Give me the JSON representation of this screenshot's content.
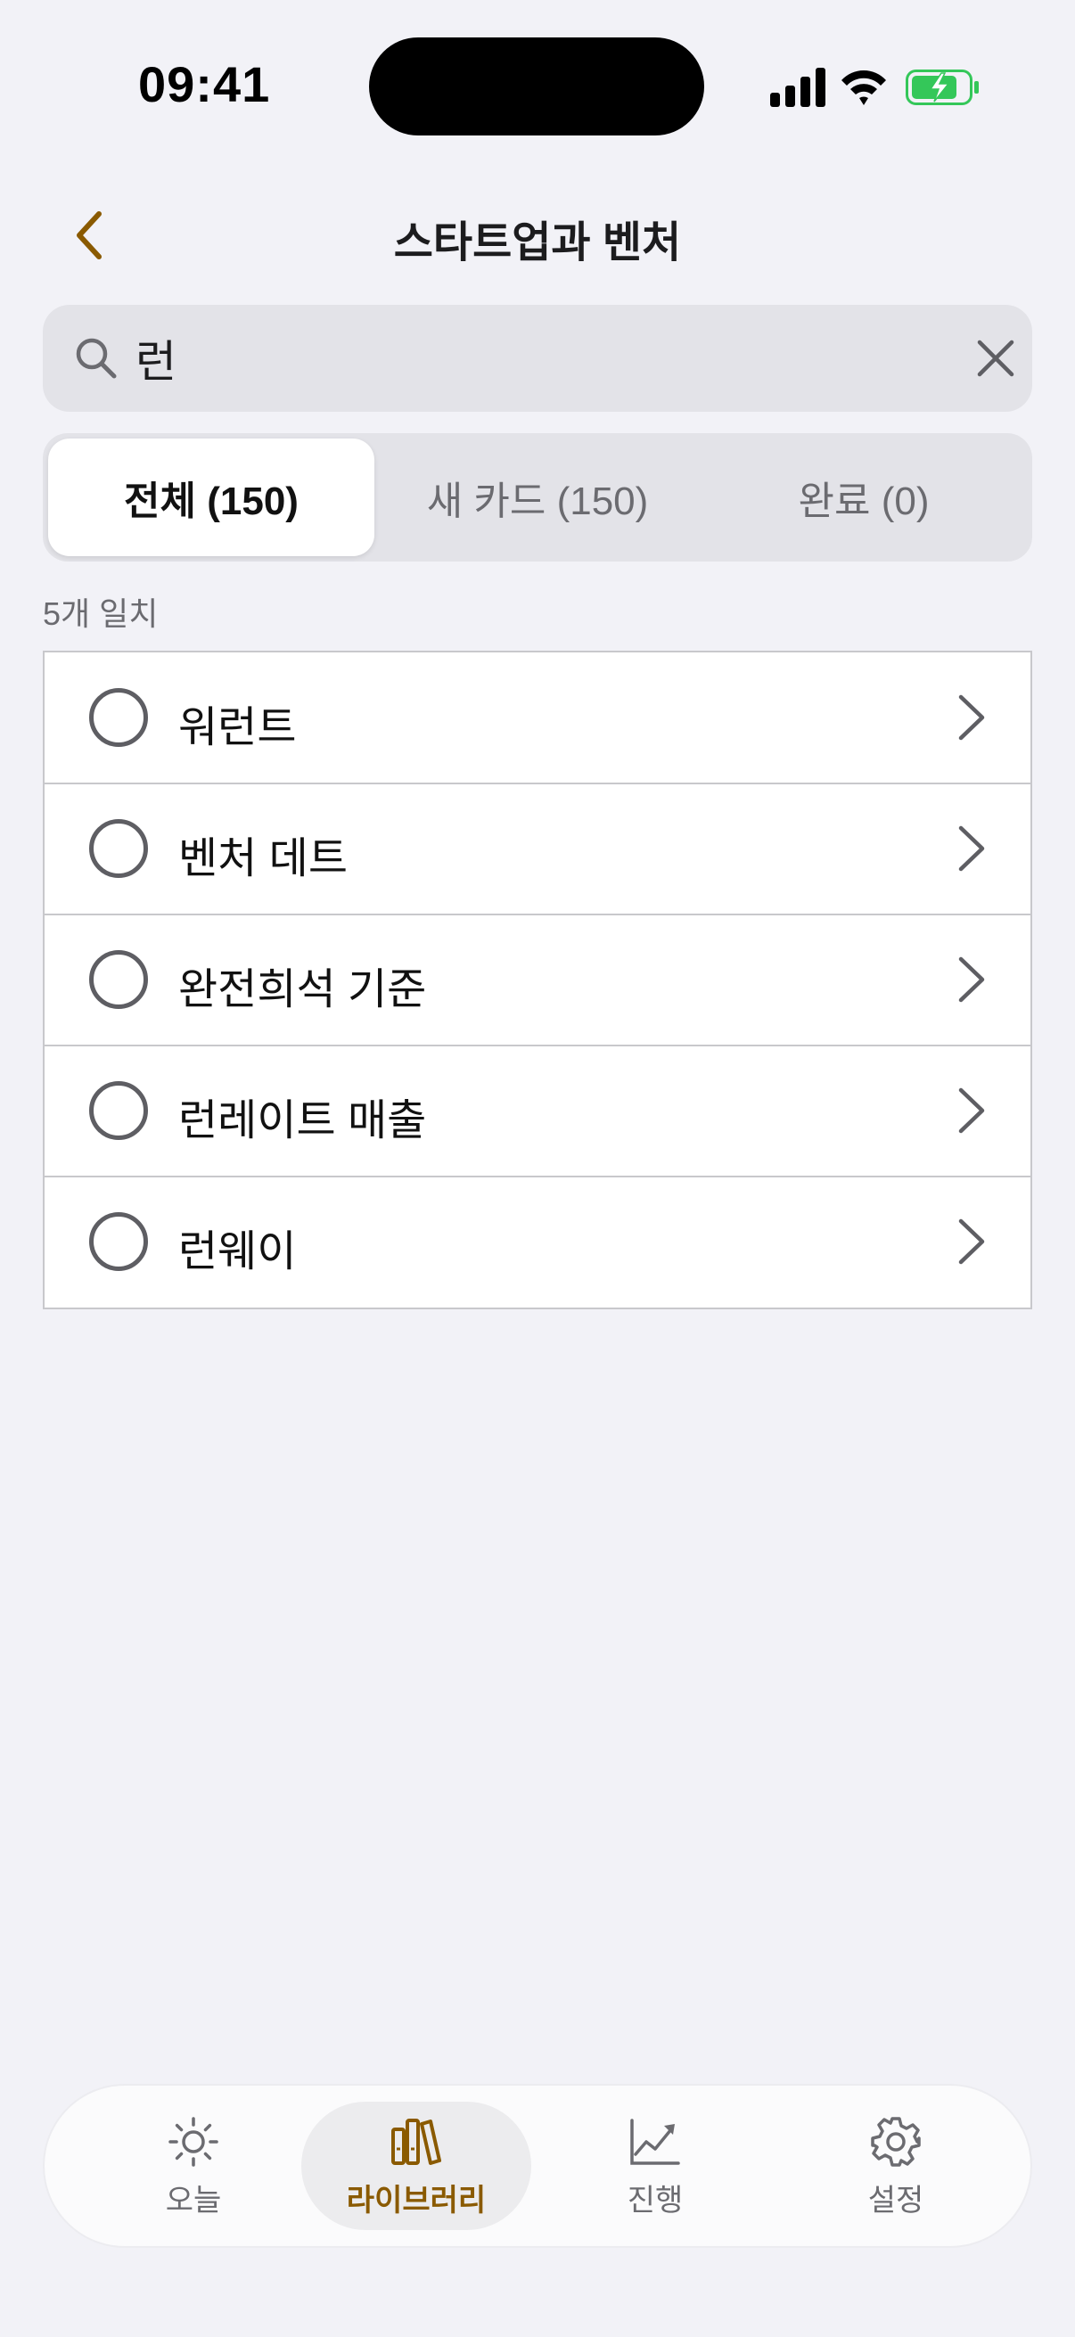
{
  "status_bar": {
    "time": "09:41"
  },
  "nav": {
    "title": "스타트업과 벤처",
    "back_icon": "chevron-left-icon"
  },
  "search": {
    "value": "런",
    "placeholder": ""
  },
  "segments": [
    {
      "label": "전체 (150)",
      "active": true
    },
    {
      "label": "새 카드 (150)",
      "active": false
    },
    {
      "label": "완료 (0)",
      "active": false
    }
  ],
  "match_count": "5개 일치",
  "cards": [
    {
      "label": "워런트"
    },
    {
      "label": "벤처 데트"
    },
    {
      "label": "완전희석 기준"
    },
    {
      "label": "런레이트 매출"
    },
    {
      "label": "런웨이"
    }
  ],
  "tab_bar": {
    "items": [
      {
        "label": "오늘",
        "icon": "sun-icon"
      },
      {
        "label": "라이브러리",
        "icon": "books-icon",
        "active": true
      },
      {
        "label": "진행",
        "icon": "chart-line-icon"
      },
      {
        "label": "설정",
        "icon": "gear-icon"
      }
    ]
  },
  "colors": {
    "accent": "#8a5a00",
    "background": "#f2f2f7",
    "battery_green": "#34c759"
  }
}
